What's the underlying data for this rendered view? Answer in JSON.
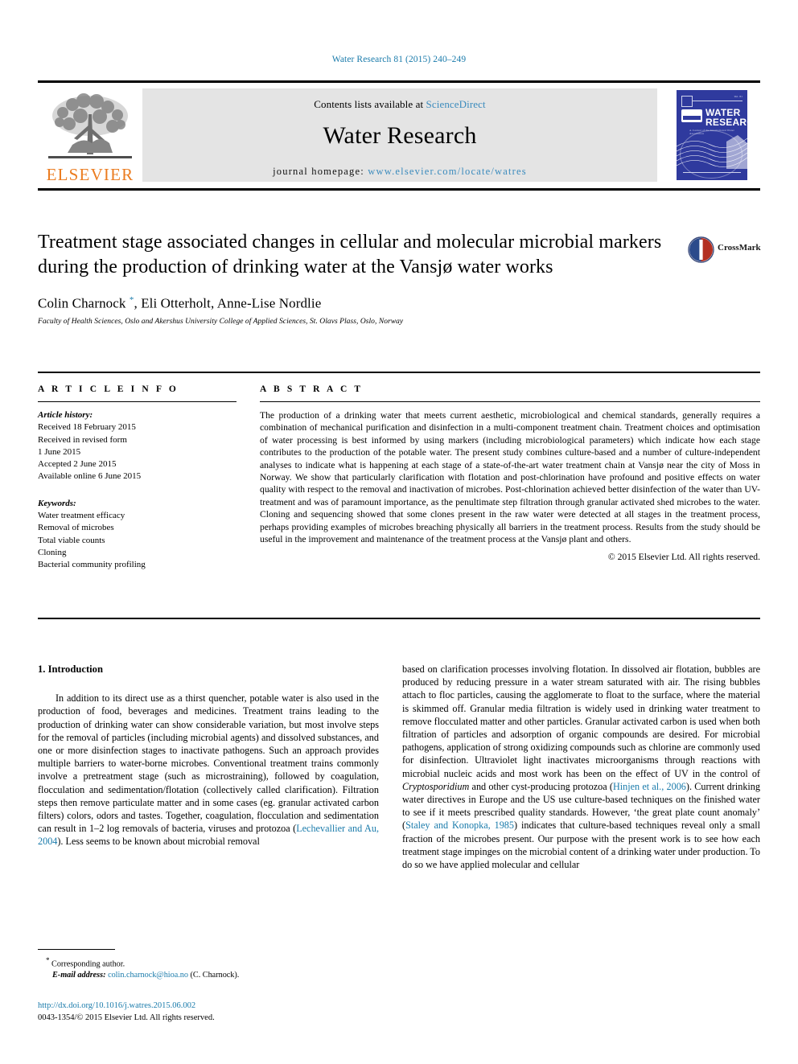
{
  "running_head": "Water Research 81 (2015) 240–249",
  "masthead": {
    "contents_prefix": "Contents lists available at ",
    "sciencedirect": "ScienceDirect",
    "journal_name": "Water Research",
    "homepage_label": "journal homepage:",
    "homepage_url": "www.elsevier.com/locate/watres",
    "publisher_logo_text": "ELSEVIER",
    "cover": {
      "title_line1": "WATER",
      "title_line2": "RESEARCH",
      "subtitle": "A Journal of the International Water Association",
      "volume_label": "Vol. 81",
      "society_logo": "IWA"
    }
  },
  "article": {
    "title": "Treatment stage associated changes in cellular and molecular microbial markers during the production of drinking water at the Vansjø water works",
    "authors": "Colin Charnock, Eli Otterholt, Anne-Lise Nordlie",
    "corresponding_marker": "*",
    "affiliation": "Faculty of Health Sciences, Oslo and Akershus University College of Applied Sciences, St. Olavs Plass, Oslo, Norway",
    "crossmark_label": "CrossMark"
  },
  "info": {
    "heading": "A R T I C L E  I N F O",
    "history_label": "Article history:",
    "history": [
      "Received 18 February 2015",
      "Received in revised form",
      "1 June 2015",
      "Accepted 2 June 2015",
      "Available online 6 June 2015"
    ],
    "keywords_label": "Keywords:",
    "keywords": [
      "Water treatment efficacy",
      "Removal of microbes",
      "Total viable counts",
      "Cloning",
      "Bacterial community profiling"
    ]
  },
  "abstract": {
    "heading": "A B S T R A C T",
    "text": "The production of a drinking water that meets current aesthetic, microbiological and chemical standards, generally requires a combination of mechanical purification and disinfection in a multi-component treatment chain. Treatment choices and optimisation of water processing is best informed by using markers (including microbiological parameters) which indicate how each stage contributes to the production of the potable water. The present study combines culture-based and a number of culture-independent analyses to indicate what is happening at each stage of a state-of-the-art water treatment chain at Vansjø near the city of Moss in Norway. We show that particularly clarification with flotation and post-chlorination have profound and positive effects on water quality with respect to the removal and inactivation of microbes. Post-chlorination achieved better disinfection of the water than UV-treatment and was of paramount importance, as the penultimate step filtration through granular activated shed microbes to the water. Cloning and sequencing showed that some clones present in the raw water were detected at all stages in the treatment process, perhaps providing examples of microbes breaching physically all barriers in the treatment process. Results from the study should be useful in the improvement and maintenance of the treatment process at the Vansjø plant and others.",
    "copyright": "© 2015 Elsevier Ltd. All rights reserved."
  },
  "introduction": {
    "heading": "1. Introduction",
    "left_paragraph_part1": "In addition to its direct use as a thirst quencher, potable water is also used in the production of food, beverages and medicines. Treatment trains leading to the production of drinking water can show considerable variation, but most involve steps for the removal of particles (including microbial agents) and dissolved substances, and one or more disinfection stages to inactivate pathogens. Such an approach provides multiple barriers to water-borne microbes. Conventional treatment trains commonly involve a pretreatment stage (such as microstraining), followed by coagulation, flocculation and sedimentation/flotation (collectively called clarification). Filtration steps then remove particulate matter and in some cases (eg. granular activated carbon filters) colors, odors and tastes. Together, coagulation, flocculation and sedimentation can result in 1–2 log removals of bacteria, viruses and protozoa (",
    "left_citation1": "Lechevallier and Au, 2004",
    "left_paragraph_part2": "). Less seems to be known about microbial removal",
    "right_part1": "based on clarification processes involving flotation. In dissolved air flotation, bubbles are produced by reducing pressure in a water stream saturated with air. The rising bubbles attach to floc particles, causing the agglomerate to float to the surface, where the material is skimmed off. Granular media filtration is widely used in drinking water treatment to remove flocculated matter and other particles. Granular activated carbon is used when both filtration of particles and adsorption of organic compounds are desired. For microbial pathogens, application of strong oxidizing compounds such as chlorine are commonly used for disinfection. Ultraviolet light inactivates microorganisms through reactions with microbial nucleic acids and most work has been on the effect of UV in the control of ",
    "right_italic1": "Cryptosporidium",
    "right_part2": " and other cyst-producing protozoa (",
    "right_citation1": "Hinjen et al., 2006",
    "right_part3": "). Current drinking water directives in Europe and the US use culture-based techniques on the finished water to see if it meets prescribed quality standards. However, ‘the great plate count anomaly’ (",
    "right_citation2": "Staley and Konopka, 1985",
    "right_part4": ") indicates that culture-based techniques reveal only a small fraction of the microbes present. Our purpose with the present work is to see how each treatment stage impinges on the microbial content of a drinking water under production. To do so we have applied molecular and cellular"
  },
  "footnotes": {
    "corresponding_marker": "*",
    "corresponding_label": "Corresponding author.",
    "email_label": "E-mail address:",
    "email": "colin.charnock@hioa.no",
    "email_suffix": "(C. Charnock).",
    "doi": "http://dx.doi.org/10.1016/j.watres.2015.06.002",
    "imprint": "0043-1354/© 2015 Elsevier Ltd. All rights reserved."
  },
  "colors": {
    "link": "#1a7bab",
    "sciencedirect": "#3b8bbd",
    "elsevier_orange": "#eb7c20",
    "cover_blue": "#2f3a9e",
    "band_grey": "#e4e4e4"
  }
}
